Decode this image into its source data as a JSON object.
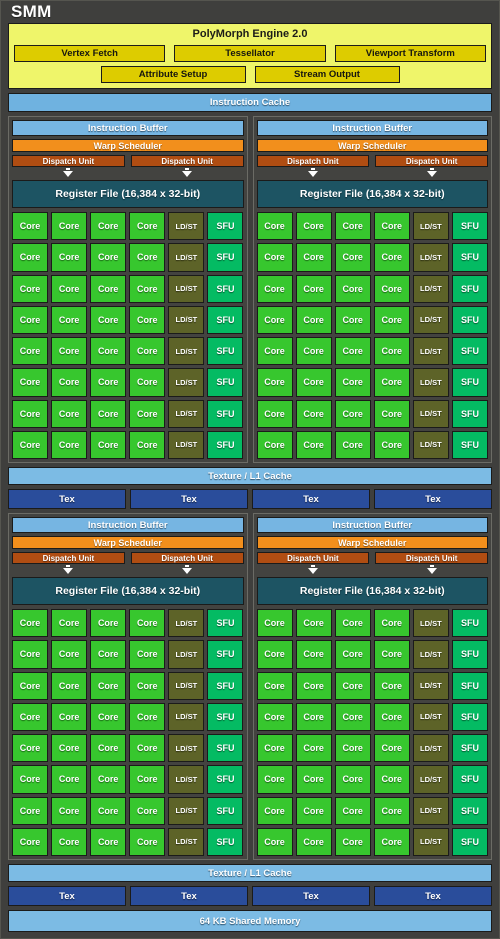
{
  "title": "SMM",
  "polymorph": {
    "title": "PolyMorph Engine 2.0",
    "row1": [
      "Vertex Fetch",
      "Tessellator",
      "Viewport Transform"
    ],
    "row2": [
      "Attribute Setup",
      "Stream Output"
    ]
  },
  "instruction_cache": "Instruction Cache",
  "block": {
    "instruction_buffer": "Instruction Buffer",
    "warp_scheduler": "Warp Scheduler",
    "dispatch_unit": "Dispatch Unit",
    "register_file": "Register File (16,384 x 32-bit)",
    "core": "Core",
    "ldst": "LD/ST",
    "sfu": "SFU",
    "rows": 8,
    "cores_per_row": 4
  },
  "texture_l1_cache": "Texture / L1 Cache",
  "tex": "Tex",
  "tex_count": 4,
  "shared_memory": "64 KB Shared Memory",
  "colors": {
    "background": "#3f3f3d",
    "polymorph_fill": "#eff56a",
    "polymorph_unit": "#ddcc00",
    "cache_blue": "#7cbbe4",
    "instruction_buffer": "#76b5e2",
    "warp_orange": "#f28f1c",
    "dispatch_brown": "#b04d12",
    "register_file_teal": "#1d5463",
    "core_green": "#37c72e",
    "ldst_olive": "#5d6328",
    "sfu_green": "#04bb63",
    "tex_blue": "#2a4d9b"
  }
}
